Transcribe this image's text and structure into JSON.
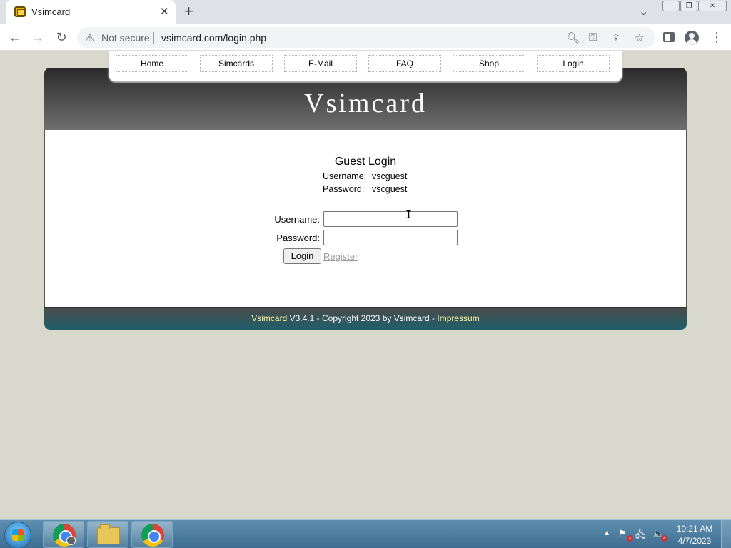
{
  "browser": {
    "tab": {
      "title": "Vsimcard",
      "close_glyph": "✕",
      "favicon": "sim-card-icon"
    },
    "new_tab_glyph": "+",
    "tab_search_glyph": "⌄",
    "window_controls": {
      "minimize": "–",
      "maximize": "❐",
      "close": "✕"
    },
    "nav": {
      "back": "←",
      "forward": "→",
      "reload": "↻"
    },
    "omnibox": {
      "security_glyph": "⚠",
      "security_label": "Not secure",
      "url": "vsimcard.com/login.php"
    },
    "toolbar_icons": {
      "zoom": "🔍︎",
      "key": "⚿",
      "share": "⇪",
      "bookmark": "☆",
      "menu": "⋮"
    }
  },
  "site": {
    "title": "Vsimcard",
    "nav": [
      "Home",
      "Simcards",
      "E-Mail",
      "FAQ",
      "Shop",
      "Login"
    ],
    "guest": {
      "heading": "Guest Login",
      "username_label": "Username:",
      "username_value": "vscguest",
      "password_label": "Password:",
      "password_value": "vscguest"
    },
    "form": {
      "username_label": "Username:",
      "username_value": "",
      "password_label": "Password:",
      "password_value": "",
      "login_button": "Login",
      "register_link": "Register"
    },
    "footer": {
      "brand": "Vsimcard",
      "text": " V3.4.1 - Copyright 2023 by Vsimcard - ",
      "link": "Impressum"
    },
    "colors": {
      "background": "#d8d8cc",
      "footer_accent": "#f5f59a",
      "link_disabled": "#9a9a9a"
    }
  },
  "taskbar": {
    "apps": [
      "start-orb",
      "chrome-profile",
      "file-explorer",
      "chrome"
    ],
    "tray": {
      "expand_glyph": "▲",
      "flag_glyph": "⚑",
      "network_glyph": "🖧",
      "volume_glyph": "🔈",
      "error_glyph": "×"
    },
    "clock": {
      "time": "10:21 AM",
      "date": "4/7/2023"
    }
  }
}
